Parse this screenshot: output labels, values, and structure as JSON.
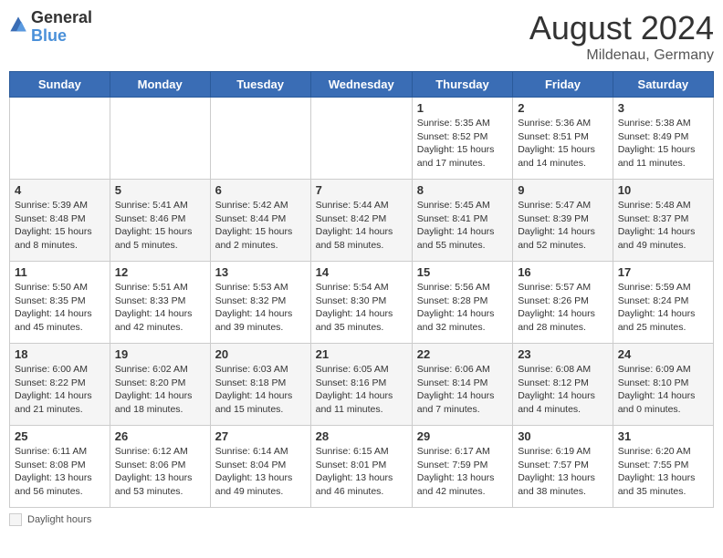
{
  "header": {
    "logo_general": "General",
    "logo_blue": "Blue",
    "month_year": "August 2024",
    "location": "Mildenau, Germany"
  },
  "days_of_week": [
    "Sunday",
    "Monday",
    "Tuesday",
    "Wednesday",
    "Thursday",
    "Friday",
    "Saturday"
  ],
  "footer": {
    "daylight_label": "Daylight hours"
  },
  "weeks": [
    {
      "days": [
        {
          "number": "",
          "info": ""
        },
        {
          "number": "",
          "info": ""
        },
        {
          "number": "",
          "info": ""
        },
        {
          "number": "",
          "info": ""
        },
        {
          "number": "1",
          "info": "Sunrise: 5:35 AM\nSunset: 8:52 PM\nDaylight: 15 hours\nand 17 minutes."
        },
        {
          "number": "2",
          "info": "Sunrise: 5:36 AM\nSunset: 8:51 PM\nDaylight: 15 hours\nand 14 minutes."
        },
        {
          "number": "3",
          "info": "Sunrise: 5:38 AM\nSunset: 8:49 PM\nDaylight: 15 hours\nand 11 minutes."
        }
      ]
    },
    {
      "days": [
        {
          "number": "4",
          "info": "Sunrise: 5:39 AM\nSunset: 8:48 PM\nDaylight: 15 hours\nand 8 minutes."
        },
        {
          "number": "5",
          "info": "Sunrise: 5:41 AM\nSunset: 8:46 PM\nDaylight: 15 hours\nand 5 minutes."
        },
        {
          "number": "6",
          "info": "Sunrise: 5:42 AM\nSunset: 8:44 PM\nDaylight: 15 hours\nand 2 minutes."
        },
        {
          "number": "7",
          "info": "Sunrise: 5:44 AM\nSunset: 8:42 PM\nDaylight: 14 hours\nand 58 minutes."
        },
        {
          "number": "8",
          "info": "Sunrise: 5:45 AM\nSunset: 8:41 PM\nDaylight: 14 hours\nand 55 minutes."
        },
        {
          "number": "9",
          "info": "Sunrise: 5:47 AM\nSunset: 8:39 PM\nDaylight: 14 hours\nand 52 minutes."
        },
        {
          "number": "10",
          "info": "Sunrise: 5:48 AM\nSunset: 8:37 PM\nDaylight: 14 hours\nand 49 minutes."
        }
      ]
    },
    {
      "days": [
        {
          "number": "11",
          "info": "Sunrise: 5:50 AM\nSunset: 8:35 PM\nDaylight: 14 hours\nand 45 minutes."
        },
        {
          "number": "12",
          "info": "Sunrise: 5:51 AM\nSunset: 8:33 PM\nDaylight: 14 hours\nand 42 minutes."
        },
        {
          "number": "13",
          "info": "Sunrise: 5:53 AM\nSunset: 8:32 PM\nDaylight: 14 hours\nand 39 minutes."
        },
        {
          "number": "14",
          "info": "Sunrise: 5:54 AM\nSunset: 8:30 PM\nDaylight: 14 hours\nand 35 minutes."
        },
        {
          "number": "15",
          "info": "Sunrise: 5:56 AM\nSunset: 8:28 PM\nDaylight: 14 hours\nand 32 minutes."
        },
        {
          "number": "16",
          "info": "Sunrise: 5:57 AM\nSunset: 8:26 PM\nDaylight: 14 hours\nand 28 minutes."
        },
        {
          "number": "17",
          "info": "Sunrise: 5:59 AM\nSunset: 8:24 PM\nDaylight: 14 hours\nand 25 minutes."
        }
      ]
    },
    {
      "days": [
        {
          "number": "18",
          "info": "Sunrise: 6:00 AM\nSunset: 8:22 PM\nDaylight: 14 hours\nand 21 minutes."
        },
        {
          "number": "19",
          "info": "Sunrise: 6:02 AM\nSunset: 8:20 PM\nDaylight: 14 hours\nand 18 minutes."
        },
        {
          "number": "20",
          "info": "Sunrise: 6:03 AM\nSunset: 8:18 PM\nDaylight: 14 hours\nand 15 minutes."
        },
        {
          "number": "21",
          "info": "Sunrise: 6:05 AM\nSunset: 8:16 PM\nDaylight: 14 hours\nand 11 minutes."
        },
        {
          "number": "22",
          "info": "Sunrise: 6:06 AM\nSunset: 8:14 PM\nDaylight: 14 hours\nand 7 minutes."
        },
        {
          "number": "23",
          "info": "Sunrise: 6:08 AM\nSunset: 8:12 PM\nDaylight: 14 hours\nand 4 minutes."
        },
        {
          "number": "24",
          "info": "Sunrise: 6:09 AM\nSunset: 8:10 PM\nDaylight: 14 hours\nand 0 minutes."
        }
      ]
    },
    {
      "days": [
        {
          "number": "25",
          "info": "Sunrise: 6:11 AM\nSunset: 8:08 PM\nDaylight: 13 hours\nand 56 minutes."
        },
        {
          "number": "26",
          "info": "Sunrise: 6:12 AM\nSunset: 8:06 PM\nDaylight: 13 hours\nand 53 minutes."
        },
        {
          "number": "27",
          "info": "Sunrise: 6:14 AM\nSunset: 8:04 PM\nDaylight: 13 hours\nand 49 minutes."
        },
        {
          "number": "28",
          "info": "Sunrise: 6:15 AM\nSunset: 8:01 PM\nDaylight: 13 hours\nand 46 minutes."
        },
        {
          "number": "29",
          "info": "Sunrise: 6:17 AM\nSunset: 7:59 PM\nDaylight: 13 hours\nand 42 minutes."
        },
        {
          "number": "30",
          "info": "Sunrise: 6:19 AM\nSunset: 7:57 PM\nDaylight: 13 hours\nand 38 minutes."
        },
        {
          "number": "31",
          "info": "Sunrise: 6:20 AM\nSunset: 7:55 PM\nDaylight: 13 hours\nand 35 minutes."
        }
      ]
    }
  ]
}
